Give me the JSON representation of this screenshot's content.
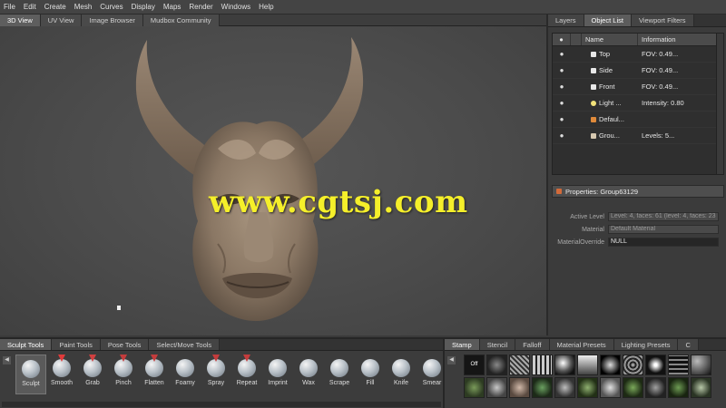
{
  "menu": [
    "File",
    "Edit",
    "Create",
    "Mesh",
    "Curves",
    "Display",
    "Maps",
    "Render",
    "Windows",
    "Help"
  ],
  "viewport_tabs": [
    {
      "label": "3D View",
      "active": true
    },
    {
      "label": "UV View",
      "active": false
    },
    {
      "label": "Image Browser",
      "active": false
    },
    {
      "label": "Mudbox Community",
      "active": false
    }
  ],
  "watermark": "www.cgtsj.com",
  "right_tabs": [
    {
      "label": "Layers",
      "active": false
    },
    {
      "label": "Object List",
      "active": true
    },
    {
      "label": "Viewport Filters",
      "active": false
    }
  ],
  "object_list": {
    "headers": {
      "name": "Name",
      "info": "Information"
    },
    "rows": [
      {
        "name": "Top",
        "info": "FOV: 0.49...",
        "icon": "camera-icon"
      },
      {
        "name": "Side",
        "info": "FOV: 0.49...",
        "icon": "camera-icon"
      },
      {
        "name": "Front",
        "info": "FOV: 0.49...",
        "icon": "camera-icon"
      },
      {
        "name": "Light ...",
        "info": "Intensity: 0.80",
        "icon": "light-icon"
      },
      {
        "name": "Defaul...",
        "info": "",
        "icon": "material-icon"
      },
      {
        "name": "Grou...",
        "info": "Levels: 5...",
        "icon": "mesh-icon"
      }
    ]
  },
  "properties": {
    "title": "Properties: Group63129",
    "rows": [
      {
        "label": "Active Level",
        "value": "Level: 4, faces: 61 (level: 4, faces: 23"
      },
      {
        "label": "Material",
        "value": "Default Material"
      },
      {
        "label": "MaterialOverride",
        "value": "NULL"
      }
    ]
  },
  "bottom_tabs": [
    {
      "label": "Sculpt Tools",
      "active": true
    },
    {
      "label": "Paint Tools",
      "active": false
    },
    {
      "label": "Pose Tools",
      "active": false
    },
    {
      "label": "Select/Move Tools",
      "active": false
    }
  ],
  "sculpt_tools": [
    {
      "label": "Sculpt",
      "active": true,
      "tip": ""
    },
    {
      "label": "Smooth",
      "active": false,
      "tip": "#e03a3a"
    },
    {
      "label": "Grab",
      "active": false,
      "tip": "#d04040"
    },
    {
      "label": "Pinch",
      "active": false,
      "tip": "#c43c3c"
    },
    {
      "label": "Flatten",
      "active": false,
      "tip": "#c43c3c"
    },
    {
      "label": "Foamy",
      "active": false,
      "tip": ""
    },
    {
      "label": "Spray",
      "active": false,
      "tip": "#c43c3c"
    },
    {
      "label": "Repeat",
      "active": false,
      "tip": "#c43c3c"
    },
    {
      "label": "Imprint",
      "active": false,
      "tip": ""
    },
    {
      "label": "Wax",
      "active": false,
      "tip": ""
    },
    {
      "label": "Scrape",
      "active": false,
      "tip": ""
    },
    {
      "label": "Fill",
      "active": false,
      "tip": ""
    },
    {
      "label": "Knife",
      "active": false,
      "tip": ""
    },
    {
      "label": "Smear",
      "active": false,
      "tip": ""
    }
  ],
  "stamp_tabs": [
    {
      "label": "Stamp",
      "active": true
    },
    {
      "label": "Stencil",
      "active": false
    },
    {
      "label": "Falloff",
      "active": false
    },
    {
      "label": "Material Presets",
      "active": false
    },
    {
      "label": "Lighting Presets",
      "active": false
    },
    {
      "label": "C",
      "active": false
    }
  ],
  "stamp_off_label": "Off",
  "colors": {
    "watermark": "#f5ef2a",
    "model": "#8a7866",
    "accent_red": "#c43c3c"
  }
}
